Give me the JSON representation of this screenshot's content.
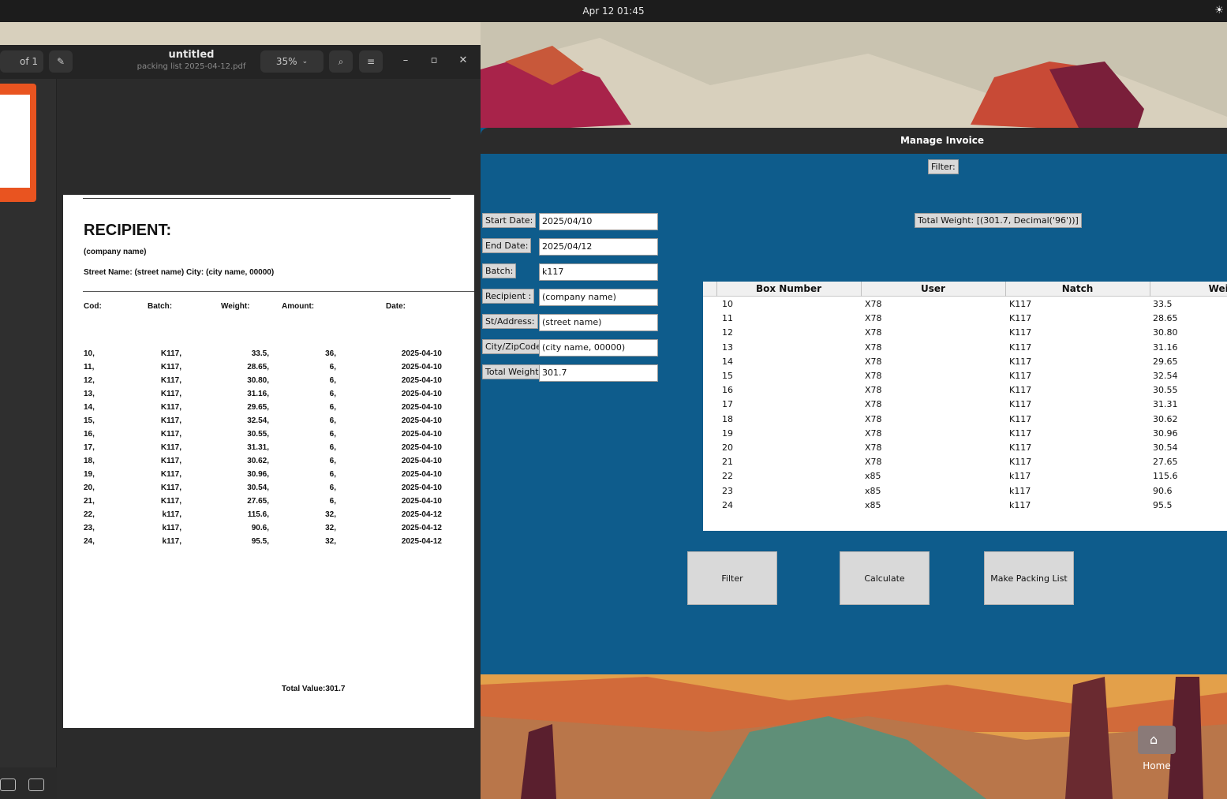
{
  "topbar": {
    "clock": "Apr 12  01:45"
  },
  "pdf_viewer": {
    "page_counter": "of 1",
    "title": "untitled",
    "subtitle": "packing list 2025-04-12.pdf",
    "zoom": "35%",
    "document": {
      "heading": "RECIPIENT:",
      "company": "(company name)",
      "address": "Street Name: (street name) City: (city name, 00000)",
      "columns": [
        "Cod:",
        "Batch:",
        "Weight:",
        "Amount:",
        "Date:"
      ],
      "rows": [
        [
          "10,",
          "K117,",
          "33.5,",
          "36,",
          "2025-04-10"
        ],
        [
          "11,",
          "K117,",
          "28.65,",
          "6,",
          "2025-04-10"
        ],
        [
          "12,",
          "K117,",
          "30.80,",
          "6,",
          "2025-04-10"
        ],
        [
          "13,",
          "K117,",
          "31.16,",
          "6,",
          "2025-04-10"
        ],
        [
          "14,",
          "K117,",
          "29.65,",
          "6,",
          "2025-04-10"
        ],
        [
          "15,",
          "K117,",
          "32.54,",
          "6,",
          "2025-04-10"
        ],
        [
          "16,",
          "K117,",
          "30.55,",
          "6,",
          "2025-04-10"
        ],
        [
          "17,",
          "K117,",
          "31.31,",
          "6,",
          "2025-04-10"
        ],
        [
          "18,",
          "K117,",
          "30.62,",
          "6,",
          "2025-04-10"
        ],
        [
          "19,",
          "K117,",
          "30.96,",
          "6,",
          "2025-04-10"
        ],
        [
          "20,",
          "K117,",
          "30.54,",
          "6,",
          "2025-04-10"
        ],
        [
          "21,",
          "K117,",
          "27.65,",
          "6,",
          "2025-04-10"
        ],
        [
          "22,",
          "k117,",
          "115.6,",
          "32,",
          "2025-04-12"
        ],
        [
          "23,",
          "k117,",
          "90.6,",
          "32,",
          "2025-04-12"
        ],
        [
          "24,",
          "k117,",
          "95.5,",
          "32,",
          "2025-04-12"
        ]
      ],
      "total": "Total Value:301.7"
    }
  },
  "manage_invoice": {
    "title": "Manage Invoice",
    "filter_label": "Filter:",
    "total_weight_label": "Total Weight: [(301.7, Decimal('96'))]",
    "fields": [
      {
        "label": "Start Date:",
        "value": "2025/04/10"
      },
      {
        "label": "End Date:",
        "value": "2025/04/12"
      },
      {
        "label": "Batch:",
        "value": "k117"
      },
      {
        "label": "Recipient :",
        "value": "(company name)"
      },
      {
        "label": "St/Address:",
        "value": "(street name)"
      },
      {
        "label": "City/ZipCode",
        "value": "(city name, 00000)"
      },
      {
        "label": "Total Weight",
        "value": "301.7"
      }
    ],
    "table": {
      "columns": [
        "Box Number",
        "User",
        "Natch",
        "Weig"
      ],
      "rows": [
        [
          "10",
          "X78",
          "K117",
          "33.5"
        ],
        [
          "11",
          "X78",
          "K117",
          "28.65"
        ],
        [
          "12",
          "X78",
          "K117",
          "30.80"
        ],
        [
          "13",
          "X78",
          "K117",
          "31.16"
        ],
        [
          "14",
          "X78",
          "K117",
          "29.65"
        ],
        [
          "15",
          "X78",
          "K117",
          "32.54"
        ],
        [
          "16",
          "X78",
          "K117",
          "30.55"
        ],
        [
          "17",
          "X78",
          "K117",
          "31.31"
        ],
        [
          "18",
          "X78",
          "K117",
          "30.62"
        ],
        [
          "19",
          "X78",
          "K117",
          "30.96"
        ],
        [
          "20",
          "X78",
          "K117",
          "30.54"
        ],
        [
          "21",
          "X78",
          "K117",
          "27.65"
        ],
        [
          "22",
          "x85",
          "k117",
          "115.6"
        ],
        [
          "23",
          "x85",
          "k117",
          "90.6"
        ],
        [
          "24",
          "x85",
          "k117",
          "95.5"
        ]
      ]
    },
    "buttons": {
      "filter": "Filter",
      "calculate": "Calculate",
      "packing": "Make Packing List"
    }
  },
  "dock": {
    "home_label": "Home"
  },
  "colors": {
    "accent": "#e95420",
    "window_bg": "#0e5c8c"
  }
}
